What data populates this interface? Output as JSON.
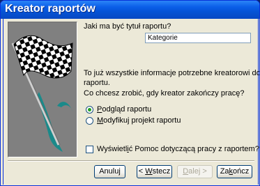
{
  "window": {
    "title": "Kreator raportów"
  },
  "form": {
    "title_prompt": "Jaki ma być tytuł raportu?",
    "title_value": "Kategorie",
    "info_line1": "To już wszystkie informacje potrzebne kreatorowi do utworzenia",
    "info_line2": "raportu.",
    "question": "Co chcesz zrobić, gdy kreator zakończy pracę?",
    "radio_preview_prefix": "",
    "radio_preview_hotkey": "P",
    "radio_preview_rest": "odgląd raportu",
    "radio_modify_prefix": "",
    "radio_modify_hotkey": "M",
    "radio_modify_rest": "odyfikuj projekt raportu",
    "selected_option": "preview",
    "help_prefix": "Wyświetl",
    "help_hotkey": "i",
    "help_rest": "ć Pomoc dotyczącą pracy z raportem?",
    "help_checked": false
  },
  "buttons": {
    "cancel": "Anuluj",
    "back_prefix": "< ",
    "back_hotkey": "W",
    "back_rest": "stecz",
    "next_prefix": "",
    "next_hotkey": "D",
    "next_rest": "alej >",
    "finish_prefix": "Za",
    "finish_hotkey": "k",
    "finish_rest": "ończ"
  },
  "icons": {
    "hero": "checkered-flag-icon"
  }
}
